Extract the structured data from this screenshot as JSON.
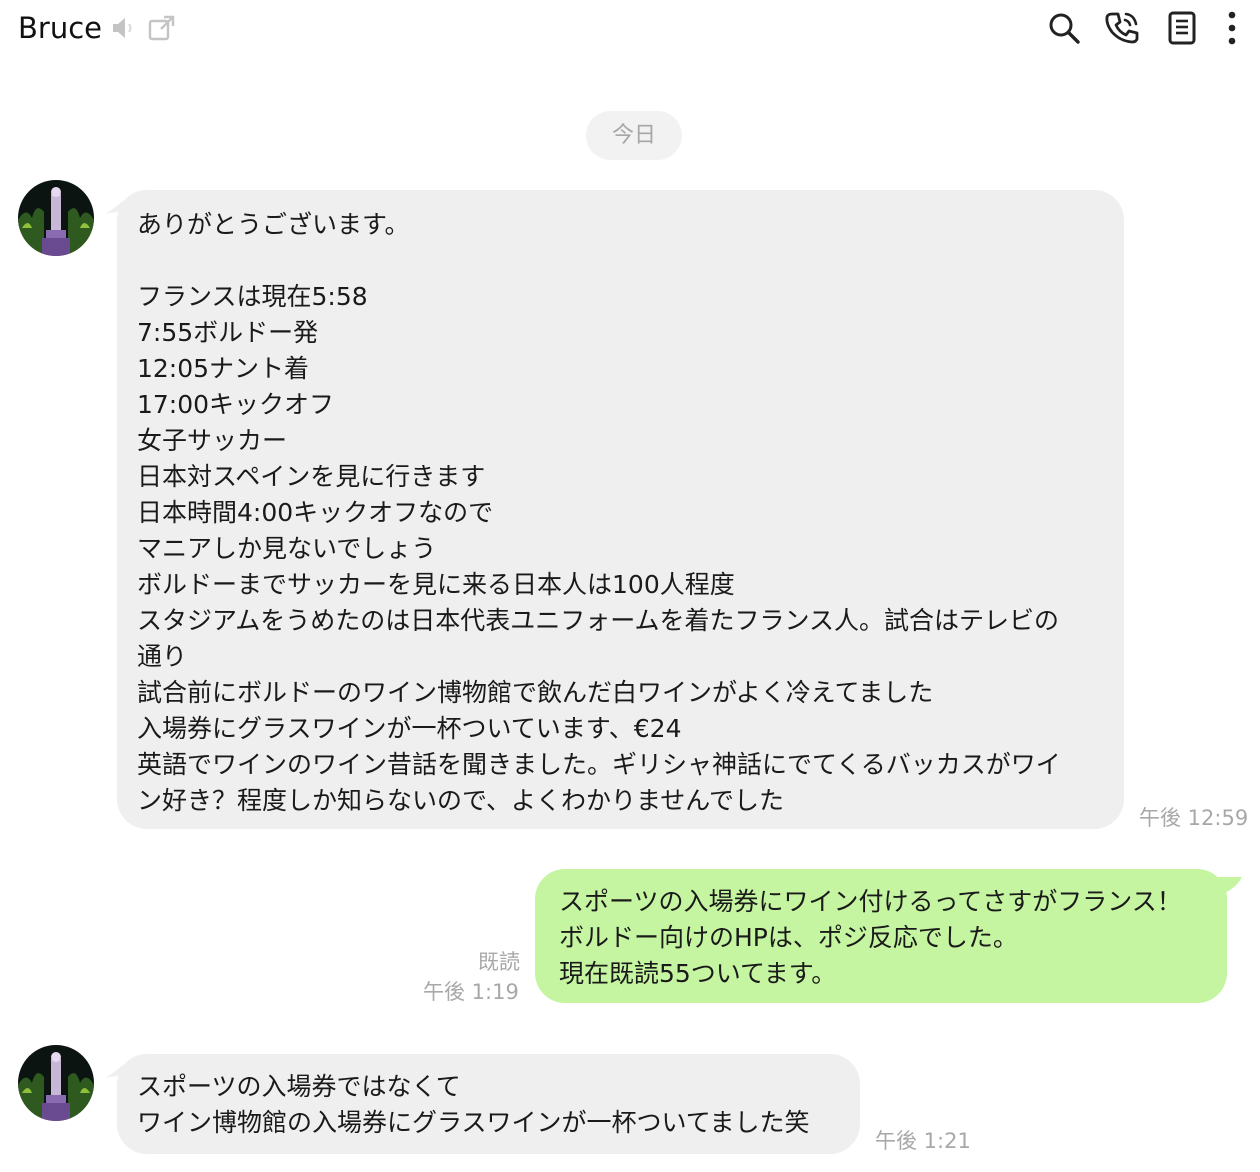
{
  "header": {
    "title": "Bruce",
    "icons": [
      "speaker-muted-icon",
      "external-window-icon",
      "search-icon",
      "phone-icon",
      "notes-icon",
      "more-vertical-icon"
    ]
  },
  "date_divider": "今日",
  "messages": [
    {
      "direction": "incoming",
      "text": "ありがとうございます。\n\nフランスは現在5:58\n7:55ボルドー発\n12:05ナント着\n17:00キックオフ\n女子サッカー\n日本対スペインを見に行きます\n日本時間4:00キックオフなので\nマニアしか見ないでしょう\nボルドーまでサッカーを見に来る日本人は100人程度\nスタジアムをうめたのは日本代表ユニフォームを着たフランス人。試合はテレビの\n通り\n試合前にボルドーのワイン博物館で飲んだ白ワインがよく冷えてました\n入場券にグラスワインが一杯ついています、€24\n英語でワインのワイン昔話を聞きました。ギリシャ神話にでてくるバッカスがワイ\nン好き？程度しか知らないので、よくわかりませんでした",
      "time": "午後 12:59"
    },
    {
      "direction": "outgoing",
      "text": "スポーツの入場券にワイン付けるってさすがフランス！\nボルドー向けのHPは、ポジ反応でした。\n現在既読55ついてます。",
      "read_label": "既読",
      "time": "午後 1:19"
    },
    {
      "direction": "incoming",
      "text": "スポーツの入場券ではなくて\nワイン博物館の入場券にグラスワインが一杯ついてました笑",
      "time": "午後 1:21"
    }
  ],
  "colors": {
    "incoming_bubble": "#efefef",
    "outgoing_bubble": "#c5f5a0",
    "meta_text": "#a8a8a8",
    "date_pill": "#f2f2f2"
  }
}
